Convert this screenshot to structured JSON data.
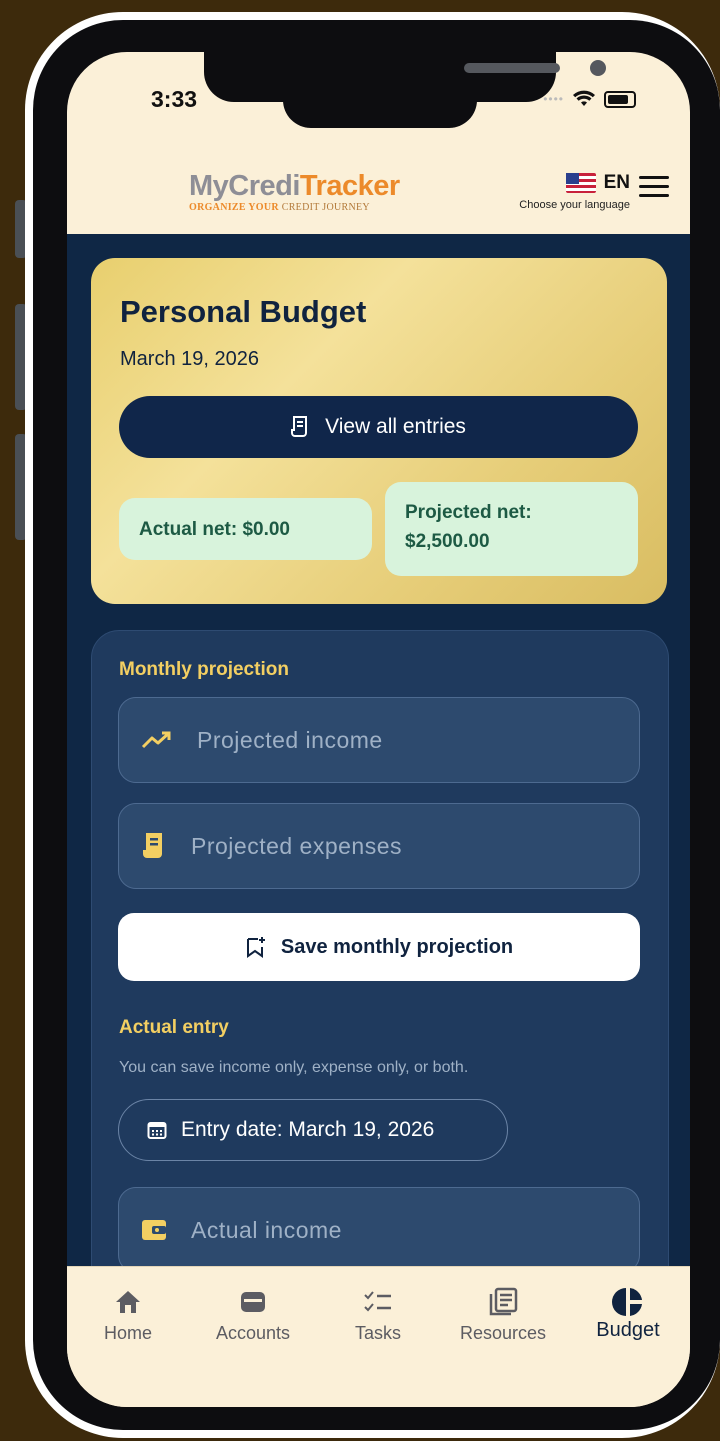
{
  "status_bar": {
    "time": "3:33"
  },
  "header": {
    "logo_part1": "MyCredi",
    "logo_part2": "Tracker",
    "tagline_highlight": "ORGANIZE YOUR",
    "tagline_rest": " CREDIT JOURNEY",
    "language_code": "EN",
    "language_hint": "Choose your language"
  },
  "budget_card": {
    "title": "Personal Budget",
    "date": "March 19, 2026",
    "view_entries_label": "View all entries",
    "actual_net": "Actual net: $0.00",
    "projected_net": "Projected net: $2,500.00"
  },
  "monthly_projection": {
    "section_title": "Monthly projection",
    "income_placeholder": "Projected income",
    "expenses_placeholder": "Projected expenses",
    "save_label": "Save monthly projection"
  },
  "actual_entry": {
    "section_title": "Actual entry",
    "hint": "You can save income only, expense only, or both.",
    "entry_date": "Entry date: March 19, 2026",
    "income_placeholder": "Actual income"
  },
  "nav": {
    "items": [
      {
        "label": "Home",
        "icon": "home-icon"
      },
      {
        "label": "Accounts",
        "icon": "wallet-icon"
      },
      {
        "label": "Tasks",
        "icon": "checklist-icon"
      },
      {
        "label": "Resources",
        "icon": "book-icon"
      },
      {
        "label": "Budget",
        "icon": "pie-chart-icon",
        "active": true
      }
    ]
  },
  "colors": {
    "navy": "#0f2745",
    "gold": "#f3cf62",
    "cream": "#fbf0d8",
    "mint": "#d8f3dc",
    "brand_orange": "#ec8a2a"
  }
}
